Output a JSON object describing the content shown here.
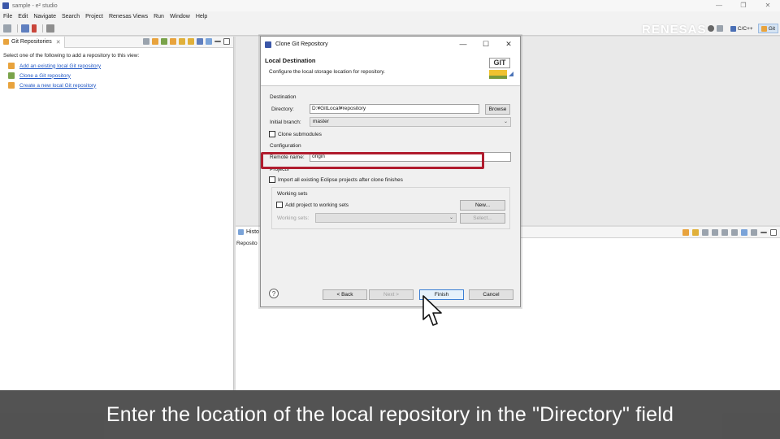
{
  "window": {
    "title": "sample - e² studio",
    "controls": [
      "—",
      "❐",
      "✕"
    ]
  },
  "menu": [
    "File",
    "Edit",
    "Navigate",
    "Search",
    "Project",
    "Renesas Views",
    "Run",
    "Window",
    "Help"
  ],
  "brand": "RENESAS",
  "perspectives": [
    {
      "label": "C/C++",
      "active": false
    },
    {
      "label": "Git",
      "active": true
    }
  ],
  "left_view": {
    "tab_label": "Git Repositories",
    "tab_close": "✕",
    "help_text": "Select one of the following to add a repository to this view:",
    "links": [
      {
        "label": "Add an existing local Git repository",
        "icon": "add-repo-icon"
      },
      {
        "label": "Clone a Git repository",
        "icon": "clone-repo-icon"
      },
      {
        "label": "Create a new local Git repository",
        "icon": "new-repo-icon"
      }
    ]
  },
  "right_view": {
    "tab_label": "Histo",
    "sub_label": "Reposito"
  },
  "dialog": {
    "title": "Clone Git Repository",
    "controls": [
      "—",
      "☐",
      "✕"
    ],
    "header_title": "Local Destination",
    "header_desc": "Configure the local storage location for repository.",
    "git_badge": "GIT",
    "destination": {
      "group_title": "Destination",
      "directory_label": "Directory:",
      "directory_value": "D:¥GitLocal¥repository",
      "browse_label": "Browse",
      "branch_label": "Initial branch:",
      "branch_value": "master",
      "submodules_label": "Clone submodules"
    },
    "configuration": {
      "group_title": "Configuration",
      "remote_label": "Remote name:",
      "remote_value": "origin"
    },
    "projects": {
      "group_title": "Projects",
      "import_label": "Import all existing Eclipse projects after clone finishes",
      "working_sets_title": "Working sets",
      "add_to_ws_label": "Add project to working sets",
      "new_label": "New...",
      "ws_label": "Working sets:",
      "select_label": "Select..."
    },
    "footer": {
      "help": "?",
      "back_label": "< Back",
      "next_label": "Next >",
      "finish_label": "Finish",
      "cancel_label": "Cancel"
    }
  },
  "caption": "Enter the location of the local repository in the \"Directory\" field",
  "colors": {
    "highlight": "#b01c2e",
    "link": "#1f56c4",
    "caption_band": "#464646"
  }
}
